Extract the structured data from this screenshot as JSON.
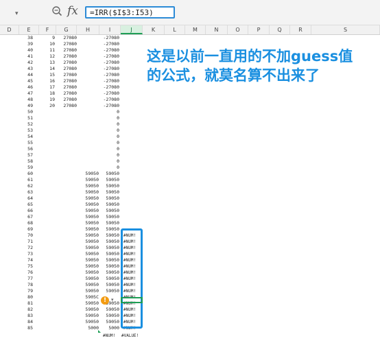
{
  "formula_bar": {
    "namebox_arrow": "▾",
    "fx_label": "fx",
    "formula": "=IRR($I$3:I53)"
  },
  "columns": [
    "D",
    "E",
    "F",
    "G",
    "H",
    "I",
    "J",
    "K",
    "L",
    "M",
    "N",
    "O",
    "P",
    "Q",
    "R",
    "S"
  ],
  "selected_column": "J",
  "rows": [
    {
      "r": "38",
      "f": "9",
      "g": "27080",
      "i": "-27080"
    },
    {
      "r": "39",
      "f": "10",
      "g": "27080",
      "i": "-27080"
    },
    {
      "r": "40",
      "f": "11",
      "g": "27080",
      "i": "-27080"
    },
    {
      "r": "41",
      "f": "12",
      "g": "27080",
      "i": "-27080"
    },
    {
      "r": "42",
      "f": "13",
      "g": "27080",
      "i": "-27080"
    },
    {
      "r": "43",
      "f": "14",
      "g": "27080",
      "i": "-27080"
    },
    {
      "r": "44",
      "f": "15",
      "g": "27080",
      "i": "-27080"
    },
    {
      "r": "45",
      "f": "16",
      "g": "27080",
      "i": "-27080"
    },
    {
      "r": "46",
      "f": "17",
      "g": "27080",
      "i": "-27080"
    },
    {
      "r": "47",
      "f": "18",
      "g": "27080",
      "i": "-27080"
    },
    {
      "r": "48",
      "f": "19",
      "g": "27080",
      "i": "-27080"
    },
    {
      "r": "49",
      "f": "20",
      "g": "27080",
      "i": "-27080"
    },
    {
      "r": "50",
      "i": "0"
    },
    {
      "r": "51",
      "i": "0"
    },
    {
      "r": "52",
      "i": "0"
    },
    {
      "r": "53",
      "i": "0"
    },
    {
      "r": "54",
      "i": "0"
    },
    {
      "r": "55",
      "i": "0"
    },
    {
      "r": "56",
      "i": "0"
    },
    {
      "r": "57",
      "i": "0"
    },
    {
      "r": "58",
      "i": "0"
    },
    {
      "r": "59",
      "i": "0"
    },
    {
      "r": "60",
      "h": "59050",
      "i": "59050"
    },
    {
      "r": "61",
      "h": "59050",
      "i": "59050"
    },
    {
      "r": "62",
      "h": "59050",
      "i": "59050"
    },
    {
      "r": "63",
      "h": "59050",
      "i": "59050"
    },
    {
      "r": "64",
      "h": "59050",
      "i": "59050"
    },
    {
      "r": "65",
      "h": "59050",
      "i": "59050"
    },
    {
      "r": "66",
      "h": "59050",
      "i": "59050"
    },
    {
      "r": "67",
      "h": "59050",
      "i": "59050"
    },
    {
      "r": "68",
      "h": "59050",
      "i": "59050"
    },
    {
      "r": "69",
      "h": "59050",
      "i": "59050"
    },
    {
      "r": "70",
      "h": "59050",
      "i": "59050",
      "j": "#NUM!"
    },
    {
      "r": "71",
      "h": "59050",
      "i": "59050",
      "j": "#NUM!"
    },
    {
      "r": "72",
      "h": "59050",
      "i": "59050",
      "j": "#NUM!"
    },
    {
      "r": "73",
      "h": "59050",
      "i": "59050",
      "j": "#NUM!"
    },
    {
      "r": "74",
      "h": "59050",
      "i": "59050",
      "j": "#NUM!"
    },
    {
      "r": "75",
      "h": "59050",
      "i": "59050",
      "j": "#NUM!"
    },
    {
      "r": "76",
      "h": "59050",
      "i": "59050",
      "j": "#NUM!"
    },
    {
      "r": "77",
      "h": "59050",
      "i": "59050",
      "j": "#NUM!"
    },
    {
      "r": "78",
      "h": "59050",
      "i": "59050",
      "j": "#NUM!"
    },
    {
      "r": "79",
      "h": "59050",
      "i": "59050",
      "j": "#NUM!"
    },
    {
      "r": "80",
      "h": "5905C",
      "i": "",
      "j": "#NUM!"
    },
    {
      "r": "81",
      "h": "59050",
      "i": "59050",
      "j": "#NUM!"
    },
    {
      "r": "82",
      "h": "59050",
      "i": "59050",
      "j": "#NUM!"
    },
    {
      "r": "83",
      "h": "59050",
      "i": "59050",
      "j": "#NUM!"
    },
    {
      "r": "84",
      "h": "59050",
      "i": "59050",
      "j": "#NUM!"
    },
    {
      "r": "85",
      "h": "5000",
      "i": "5000",
      "j": "#NUM!"
    }
  ],
  "bottom_errors": {
    "left": "#NUM!",
    "right": "#VALUE!"
  },
  "annotation": {
    "line1": "这是以前一直用的不加guess值",
    "line2": "的公式，就莫名算不出来了"
  },
  "warn_icon": "!",
  "warn_arrow": "▾",
  "colors": {
    "accent_blue": "#1a8fe0",
    "active_green": "#1e9e55",
    "warn_orange": "#f39c12"
  }
}
